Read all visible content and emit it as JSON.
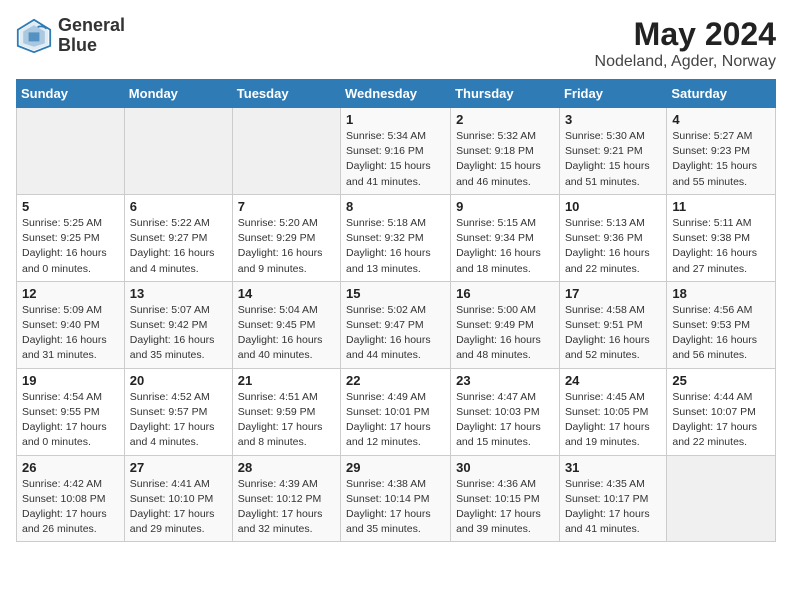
{
  "logo": {
    "line1": "General",
    "line2": "Blue"
  },
  "title": "May 2024",
  "subtitle": "Nodeland, Agder, Norway",
  "header_days": [
    "Sunday",
    "Monday",
    "Tuesday",
    "Wednesday",
    "Thursday",
    "Friday",
    "Saturday"
  ],
  "weeks": [
    [
      {
        "day": "",
        "info": ""
      },
      {
        "day": "",
        "info": ""
      },
      {
        "day": "",
        "info": ""
      },
      {
        "day": "1",
        "info": "Sunrise: 5:34 AM\nSunset: 9:16 PM\nDaylight: 15 hours\nand 41 minutes."
      },
      {
        "day": "2",
        "info": "Sunrise: 5:32 AM\nSunset: 9:18 PM\nDaylight: 15 hours\nand 46 minutes."
      },
      {
        "day": "3",
        "info": "Sunrise: 5:30 AM\nSunset: 9:21 PM\nDaylight: 15 hours\nand 51 minutes."
      },
      {
        "day": "4",
        "info": "Sunrise: 5:27 AM\nSunset: 9:23 PM\nDaylight: 15 hours\nand 55 minutes."
      }
    ],
    [
      {
        "day": "5",
        "info": "Sunrise: 5:25 AM\nSunset: 9:25 PM\nDaylight: 16 hours\nand 0 minutes."
      },
      {
        "day": "6",
        "info": "Sunrise: 5:22 AM\nSunset: 9:27 PM\nDaylight: 16 hours\nand 4 minutes."
      },
      {
        "day": "7",
        "info": "Sunrise: 5:20 AM\nSunset: 9:29 PM\nDaylight: 16 hours\nand 9 minutes."
      },
      {
        "day": "8",
        "info": "Sunrise: 5:18 AM\nSunset: 9:32 PM\nDaylight: 16 hours\nand 13 minutes."
      },
      {
        "day": "9",
        "info": "Sunrise: 5:15 AM\nSunset: 9:34 PM\nDaylight: 16 hours\nand 18 minutes."
      },
      {
        "day": "10",
        "info": "Sunrise: 5:13 AM\nSunset: 9:36 PM\nDaylight: 16 hours\nand 22 minutes."
      },
      {
        "day": "11",
        "info": "Sunrise: 5:11 AM\nSunset: 9:38 PM\nDaylight: 16 hours\nand 27 minutes."
      }
    ],
    [
      {
        "day": "12",
        "info": "Sunrise: 5:09 AM\nSunset: 9:40 PM\nDaylight: 16 hours\nand 31 minutes."
      },
      {
        "day": "13",
        "info": "Sunrise: 5:07 AM\nSunset: 9:42 PM\nDaylight: 16 hours\nand 35 minutes."
      },
      {
        "day": "14",
        "info": "Sunrise: 5:04 AM\nSunset: 9:45 PM\nDaylight: 16 hours\nand 40 minutes."
      },
      {
        "day": "15",
        "info": "Sunrise: 5:02 AM\nSunset: 9:47 PM\nDaylight: 16 hours\nand 44 minutes."
      },
      {
        "day": "16",
        "info": "Sunrise: 5:00 AM\nSunset: 9:49 PM\nDaylight: 16 hours\nand 48 minutes."
      },
      {
        "day": "17",
        "info": "Sunrise: 4:58 AM\nSunset: 9:51 PM\nDaylight: 16 hours\nand 52 minutes."
      },
      {
        "day": "18",
        "info": "Sunrise: 4:56 AM\nSunset: 9:53 PM\nDaylight: 16 hours\nand 56 minutes."
      }
    ],
    [
      {
        "day": "19",
        "info": "Sunrise: 4:54 AM\nSunset: 9:55 PM\nDaylight: 17 hours\nand 0 minutes."
      },
      {
        "day": "20",
        "info": "Sunrise: 4:52 AM\nSunset: 9:57 PM\nDaylight: 17 hours\nand 4 minutes."
      },
      {
        "day": "21",
        "info": "Sunrise: 4:51 AM\nSunset: 9:59 PM\nDaylight: 17 hours\nand 8 minutes."
      },
      {
        "day": "22",
        "info": "Sunrise: 4:49 AM\nSunset: 10:01 PM\nDaylight: 17 hours\nand 12 minutes."
      },
      {
        "day": "23",
        "info": "Sunrise: 4:47 AM\nSunset: 10:03 PM\nDaylight: 17 hours\nand 15 minutes."
      },
      {
        "day": "24",
        "info": "Sunrise: 4:45 AM\nSunset: 10:05 PM\nDaylight: 17 hours\nand 19 minutes."
      },
      {
        "day": "25",
        "info": "Sunrise: 4:44 AM\nSunset: 10:07 PM\nDaylight: 17 hours\nand 22 minutes."
      }
    ],
    [
      {
        "day": "26",
        "info": "Sunrise: 4:42 AM\nSunset: 10:08 PM\nDaylight: 17 hours\nand 26 minutes."
      },
      {
        "day": "27",
        "info": "Sunrise: 4:41 AM\nSunset: 10:10 PM\nDaylight: 17 hours\nand 29 minutes."
      },
      {
        "day": "28",
        "info": "Sunrise: 4:39 AM\nSunset: 10:12 PM\nDaylight: 17 hours\nand 32 minutes."
      },
      {
        "day": "29",
        "info": "Sunrise: 4:38 AM\nSunset: 10:14 PM\nDaylight: 17 hours\nand 35 minutes."
      },
      {
        "day": "30",
        "info": "Sunrise: 4:36 AM\nSunset: 10:15 PM\nDaylight: 17 hours\nand 39 minutes."
      },
      {
        "day": "31",
        "info": "Sunrise: 4:35 AM\nSunset: 10:17 PM\nDaylight: 17 hours\nand 41 minutes."
      },
      {
        "day": "",
        "info": ""
      }
    ]
  ]
}
